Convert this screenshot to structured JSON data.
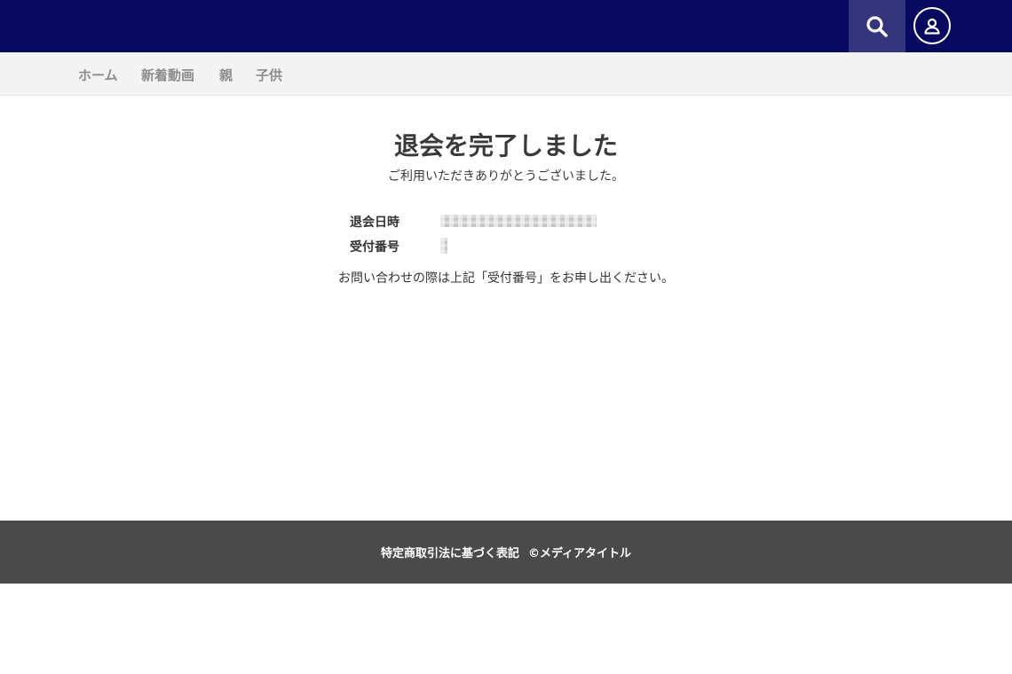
{
  "header": {
    "background": "#070a5e",
    "search_icon": "search-icon",
    "account_icon": "user-icon"
  },
  "nav": {
    "items": [
      {
        "label": "ホーム"
      },
      {
        "label": "新着動画"
      },
      {
        "label": "親"
      },
      {
        "label": "子供"
      }
    ]
  },
  "main": {
    "title": "退会を完了しました",
    "subtitle": "ご利用いただきありがとうございました。",
    "details": [
      {
        "label": "退会日時"
      },
      {
        "label": "受付番号"
      }
    ],
    "note": "お問い合わせの際は上記「受付番号」をお申し出ください。"
  },
  "footer": {
    "background": "#4a4a4a",
    "link_label": "特定商取引法に基づく表記",
    "copyright": "©メディアタイトル"
  }
}
